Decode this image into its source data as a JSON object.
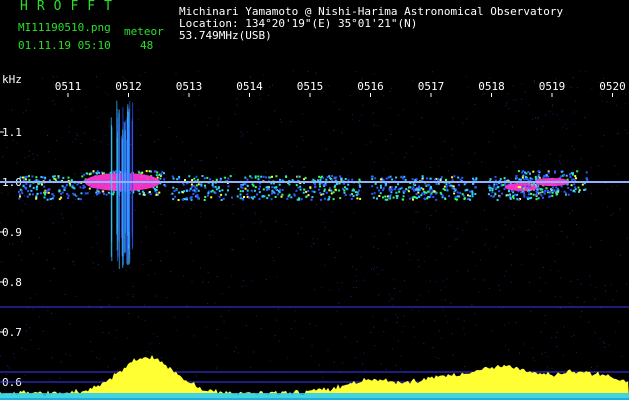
{
  "header": {
    "brand": "HROFFT",
    "filename": "MI11190510.png",
    "timestamp": "01.11.19 05:10",
    "meteor_label": "meteor",
    "meteor_count": "48",
    "observer": "Michinari Yamamoto @ Nishi-Harima Astronomical Observatory",
    "location": "Location: 134°20'19\"(E) 35°01'21\"(N)",
    "frequency": "53.749MHz(USB)"
  },
  "colors": {
    "text": "#ffffff",
    "accent": "#28e028",
    "background": "#000000",
    "echo_core": "#ff33cc",
    "signal_line": "#8fb4ff",
    "spectrum_fill": "#ffff33",
    "noise_floor": "#22ccff"
  },
  "chart_data": {
    "type": "heatmap",
    "y_unit_label": "kHz",
    "ylim": [
      0.58,
      1.17
    ],
    "x_ticks": [
      "0511",
      "0512",
      "0513",
      "0514",
      "0515",
      "0516",
      "0517",
      "0518",
      "0519",
      "0520"
    ],
    "y_ticks": [
      {
        "value": 1.1,
        "label": "1.1"
      },
      {
        "value": 1.0,
        "label": "1.0"
      },
      {
        "value": 0.9,
        "label": "0.9"
      },
      {
        "value": 0.8,
        "label": "0.8"
      },
      {
        "value": 0.7,
        "label": "0.7"
      },
      {
        "value": 0.6,
        "label": "0.6"
      }
    ],
    "carrier_khz": 1.0,
    "reference_lines_khz": [
      0.75,
      0.62,
      0.6
    ],
    "echoes": [
      {
        "minute": 10.7,
        "freq_khz": 0.99,
        "intensity": 0.5
      },
      {
        "minute": 11.9,
        "freq_khz": 1.0,
        "intensity": 1.0
      },
      {
        "minute": 13.2,
        "freq_khz": 0.99,
        "intensity": 0.4
      },
      {
        "minute": 14.3,
        "freq_khz": 0.99,
        "intensity": 0.45
      },
      {
        "minute": 15.3,
        "freq_khz": 0.99,
        "intensity": 0.45
      },
      {
        "minute": 16.5,
        "freq_khz": 0.99,
        "intensity": 0.4
      },
      {
        "minute": 17.2,
        "freq_khz": 0.99,
        "intensity": 0.55
      },
      {
        "minute": 18.5,
        "freq_khz": 0.99,
        "intensity": 0.6
      },
      {
        "minute": 19.0,
        "freq_khz": 1.0,
        "intensity": 0.7
      }
    ],
    "spectrum_peaks": [
      {
        "minute": 12.3,
        "level": 1.0
      },
      {
        "minute": 16.0,
        "level": 0.35
      },
      {
        "minute": 17.2,
        "level": 0.4
      },
      {
        "minute": 18.2,
        "level": 0.7
      },
      {
        "minute": 19.3,
        "level": 0.45
      },
      {
        "minute": 20.0,
        "level": 0.3
      }
    ]
  }
}
